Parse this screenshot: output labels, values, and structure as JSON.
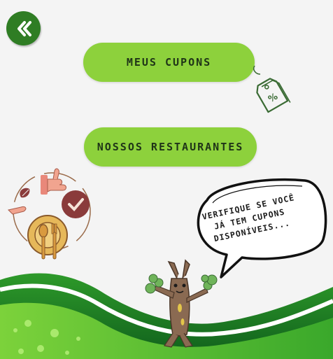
{
  "menu": {
    "my_coupons_label": "MEUS CUPONS",
    "restaurants_label": "NOSSOS RESTAURANTES"
  },
  "bubble": {
    "line1": "VERIFIQUE SE VOCÊ",
    "line2": "JÁ TEM CUPONS",
    "line3": "DISPONÍVEIS..."
  },
  "icons": {
    "back": "double-chevron-left-icon",
    "coupon": "coupon-tag-icon",
    "food_circle": "food-service-illustration",
    "mascot": "tree-mascot-illustration"
  },
  "colors": {
    "primary_green": "#8dd13c",
    "dark_green": "#2f7d24",
    "background": "#f4f4f4"
  }
}
